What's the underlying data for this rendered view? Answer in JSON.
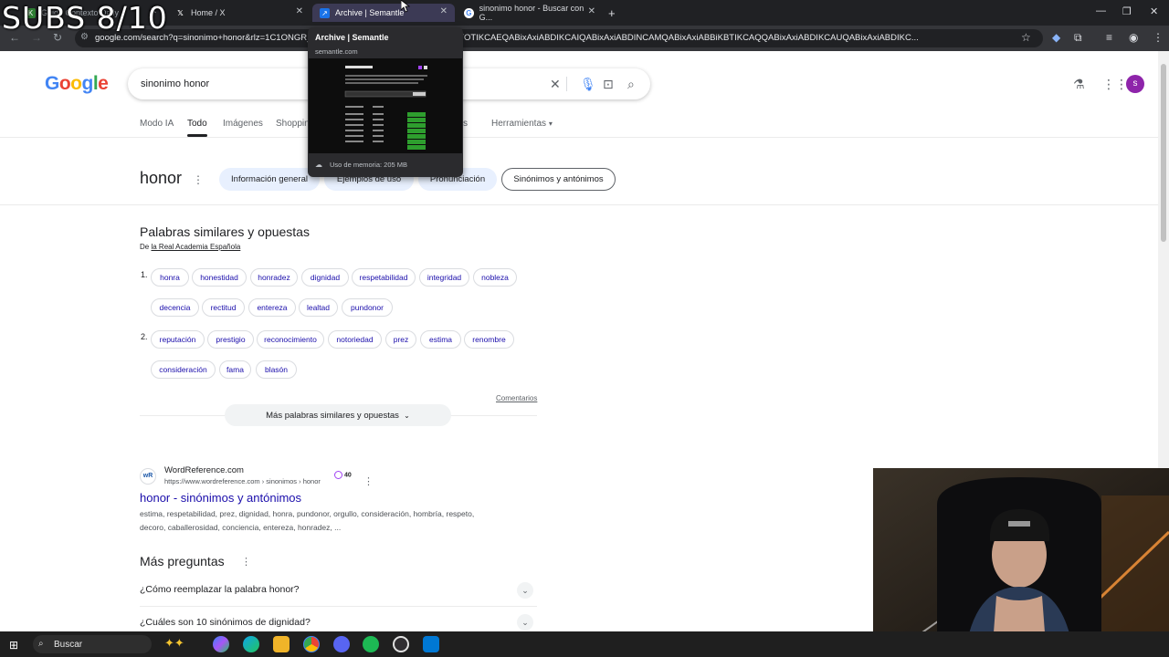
{
  "overlay": {
    "subs": "SUBS 8/10"
  },
  "browser": {
    "tabs": [
      {
        "label": "Guide Contexto Daily",
        "active": false
      },
      {
        "label": "Home / X",
        "active": false
      },
      {
        "label": "Archive | Semantle",
        "active": true
      },
      {
        "label": "sinonimo honor - Buscar con G...",
        "active": false
      }
    ],
    "url": "google.com/search?q=sinonimo+honor&rlz=1C1ONGR_...&gs_lcrp=EgZjaHJvbWUyBggAEEUYOTIKCAEQABixAxiABDIKCAIQABixAxiABDINCAMQABixAxiABBiKBTIKCAQQABixAxiABDIKCAUQABixAxiABDIKC...",
    "hover_card": {
      "title": "Archive | Semantle",
      "domain": "semantle.com",
      "memory": "Uso de memoria: 205 MB"
    }
  },
  "google": {
    "logo": "Google",
    "query": "sinonimo honor",
    "avatar": "s",
    "nav_tabs": [
      "Modo IA",
      "Todo",
      "Imágenes",
      "Shoppin",
      "s",
      "Herramientas"
    ],
    "word": "honor",
    "chips": [
      "Información general",
      "Ejemplos de uso",
      "Pronunciación",
      "Sinónimos y antónimos"
    ],
    "panel": {
      "title": "Palabras similares y opuestas",
      "source_prefix": "De",
      "source": "la Real Academia Española",
      "group1_num": "1.",
      "group2_num": "2.",
      "row1": [
        "honra",
        "honestidad",
        "honradez",
        "dignidad",
        "respetabilidad",
        "integridad",
        "nobleza"
      ],
      "row2": [
        "decencia",
        "rectitud",
        "entereza",
        "lealtad",
        "pundonor"
      ],
      "row3": [
        "reputación",
        "prestigio",
        "reconocimiento",
        "notoriedad",
        "prez",
        "estima",
        "renombre"
      ],
      "row4": [
        "consideración",
        "fama",
        "blasón"
      ],
      "comentarios": "Comentarios",
      "more": "Más palabras similares y opuestas"
    },
    "result": {
      "site": "WordReference.com",
      "url": "https://www.wordreference.com › sinonimos › honor",
      "badge": "40",
      "title": "honor - sinónimos y antónimos",
      "snippet1": "estima, respetabilidad, prez, dignidad, honra, pundonor, orgullo, consideración, hombría, respeto,",
      "snippet2": "decoro, caballerosidad, conciencia, entereza, honradez, ..."
    },
    "mas_preguntas": {
      "title": "Más preguntas",
      "questions": [
        "¿Cómo reemplazar la palabra honor?",
        "¿Cuáles son 10 sinónimos de dignidad?"
      ]
    }
  },
  "taskbar": {
    "search": "Buscar"
  }
}
